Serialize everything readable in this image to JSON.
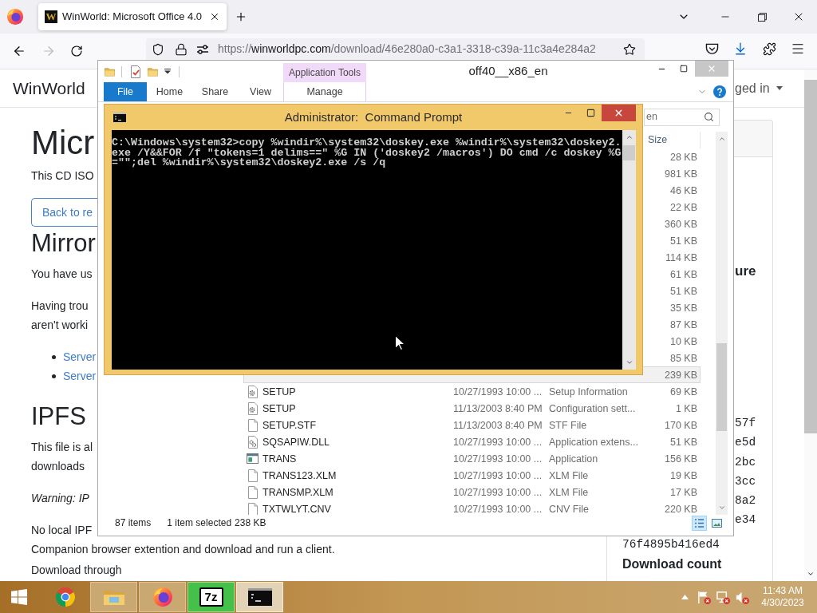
{
  "browser": {
    "tabs": [
      {
        "favicon": "W",
        "title": "WinWorld: Microsoft Office 4.0",
        "selected": true
      }
    ],
    "url": {
      "scheme": "https://",
      "host": "winworldpc.com",
      "path": "/download/46e280a0-c3a1-3318-c39a-11c3a4e284a2"
    }
  },
  "page": {
    "site_name": "WinWorld",
    "account_menu": "ged in",
    "main": [
      {
        "kind": "h1",
        "text": "Micr"
      },
      {
        "kind": "p",
        "text": "This CD ISO"
      },
      {
        "kind": "button",
        "text": "Back to re"
      },
      {
        "kind": "h2",
        "text": "Mirror"
      },
      {
        "kind": "p",
        "text": "You have us"
      },
      {
        "kind": "p",
        "text": "Having trou"
      },
      {
        "kind": "line",
        "text": "aren't worki"
      },
      {
        "kind": "bullet",
        "text": "Server"
      },
      {
        "kind": "bullet",
        "text": "Server"
      },
      {
        "kind": "h2",
        "text": "IPFS"
      },
      {
        "kind": "p",
        "text": "This file is al"
      },
      {
        "kind": "line",
        "text": "downloads"
      },
      {
        "kind": "italic",
        "text": "Warning: IP"
      },
      {
        "kind": "p",
        "text": "No local IPF"
      },
      {
        "kind": "line",
        "text": "Companion browser extention and download and run a client."
      },
      {
        "kind": "p",
        "text": "Download through"
      }
    ],
    "sidebar": {
      "heading": "ure",
      "hash_tails": [
        "57f",
        "e5d",
        "2bc",
        "3cc",
        "8a2",
        "e34"
      ],
      "hash_line": "76f4895b416ed4",
      "download_count_label": "Download count"
    }
  },
  "explorer": {
    "title": "off40__x86_en",
    "ribbon_tabs": [
      {
        "kind": "file",
        "label": "File"
      },
      {
        "kind": "tab",
        "label": "Home"
      },
      {
        "kind": "tab",
        "label": "Share"
      },
      {
        "kind": "tab",
        "label": "View"
      },
      {
        "kind": "contextual",
        "label": "Manage",
        "group": "Application Tools"
      }
    ],
    "search": {
      "placeholder": "en"
    },
    "size_column": "Size",
    "files": [
      {
        "size": "28 KB",
        "selected": false
      },
      {
        "size": "981 KB",
        "selected": false
      },
      {
        "size": "46 KB",
        "selected": false
      },
      {
        "size": "22 KB",
        "selected": false
      },
      {
        "size": "360 KB",
        "selected": false
      },
      {
        "size": "51 KB",
        "selected": false
      },
      {
        "size": "114 KB",
        "selected": false
      },
      {
        "size": "61 KB",
        "selected": false
      },
      {
        "size": "51 KB",
        "selected": false
      },
      {
        "size": "35 KB",
        "selected": false
      },
      {
        "size": "87 KB",
        "selected": false
      },
      {
        "size": "10 KB",
        "selected": false
      },
      {
        "size": "85 KB",
        "selected": false
      },
      {
        "size": "239 KB",
        "selected": true
      },
      {
        "kind": "settings",
        "name": "SETUP",
        "date": "10/27/1993 10:00 ...",
        "type": "Setup Information",
        "size": "69 KB",
        "selected": false
      },
      {
        "kind": "settings",
        "name": "SETUP",
        "date": "11/13/2003 8:40 PM",
        "type": "Configuration sett...",
        "size": "1 KB",
        "selected": false
      },
      {
        "kind": "plain",
        "name": "SETUP.STF",
        "date": "11/13/2003 8:40 PM",
        "type": "STF File",
        "size": "170 KB",
        "selected": false
      },
      {
        "kind": "library",
        "name": "SQSAPIW.DLL",
        "date": "10/27/1993 10:00 ...",
        "type": "Application extens...",
        "size": "51 KB",
        "selected": false
      },
      {
        "kind": "program",
        "name": "TRANS",
        "date": "10/27/1993 10:00 ...",
        "type": "Application",
        "size": "156 KB",
        "selected": false
      },
      {
        "kind": "plain",
        "name": "TRANS123.XLM",
        "date": "10/27/1993 10:00 ...",
        "type": "XLM File",
        "size": "19 KB",
        "selected": false
      },
      {
        "kind": "plain",
        "name": "TRANSMP.XLM",
        "date": "10/27/1993 10:00 ...",
        "type": "XLM File",
        "size": "17 KB",
        "selected": false
      },
      {
        "kind": "plain",
        "name": "TXTWLYT.CNV",
        "date": "10/27/1993 10:00 ...",
        "type": "CNV File",
        "size": "220 KB",
        "selected": false
      }
    ],
    "status": {
      "items": "87 items",
      "selection": "1 item selected",
      "selection_size": "238 KB"
    },
    "views": [
      {
        "kind": "details",
        "selected": true
      },
      {
        "kind": "thumbnails",
        "selected": false
      }
    ]
  },
  "command_prompt": {
    "title": "Administrator:  Command Prompt",
    "output": "C:\\Windows\\system32>copy %windir%\\system32\\doskey.exe %windir%\\system32\\doskey2.exe /Y&&FOR /f \"tokens=1 delims==\" %G IN ('doskey2 /macros') DO cmd /c doskey %G=\"\";del %windir%\\system32\\doskey2.exe /s /q"
  },
  "taskbar": {
    "apps": [
      {
        "kind": "chrome",
        "running": false,
        "active": false
      },
      {
        "kind": "explorer",
        "running": true,
        "active": false
      },
      {
        "kind": "firefox",
        "running": true,
        "active": false
      },
      {
        "kind": "archiver",
        "label": "7z",
        "running": true,
        "active": false
      },
      {
        "kind": "console",
        "running": true,
        "active": true
      }
    ],
    "clock": {
      "time": "11:43 AM",
      "date": "4/30/2023"
    }
  }
}
